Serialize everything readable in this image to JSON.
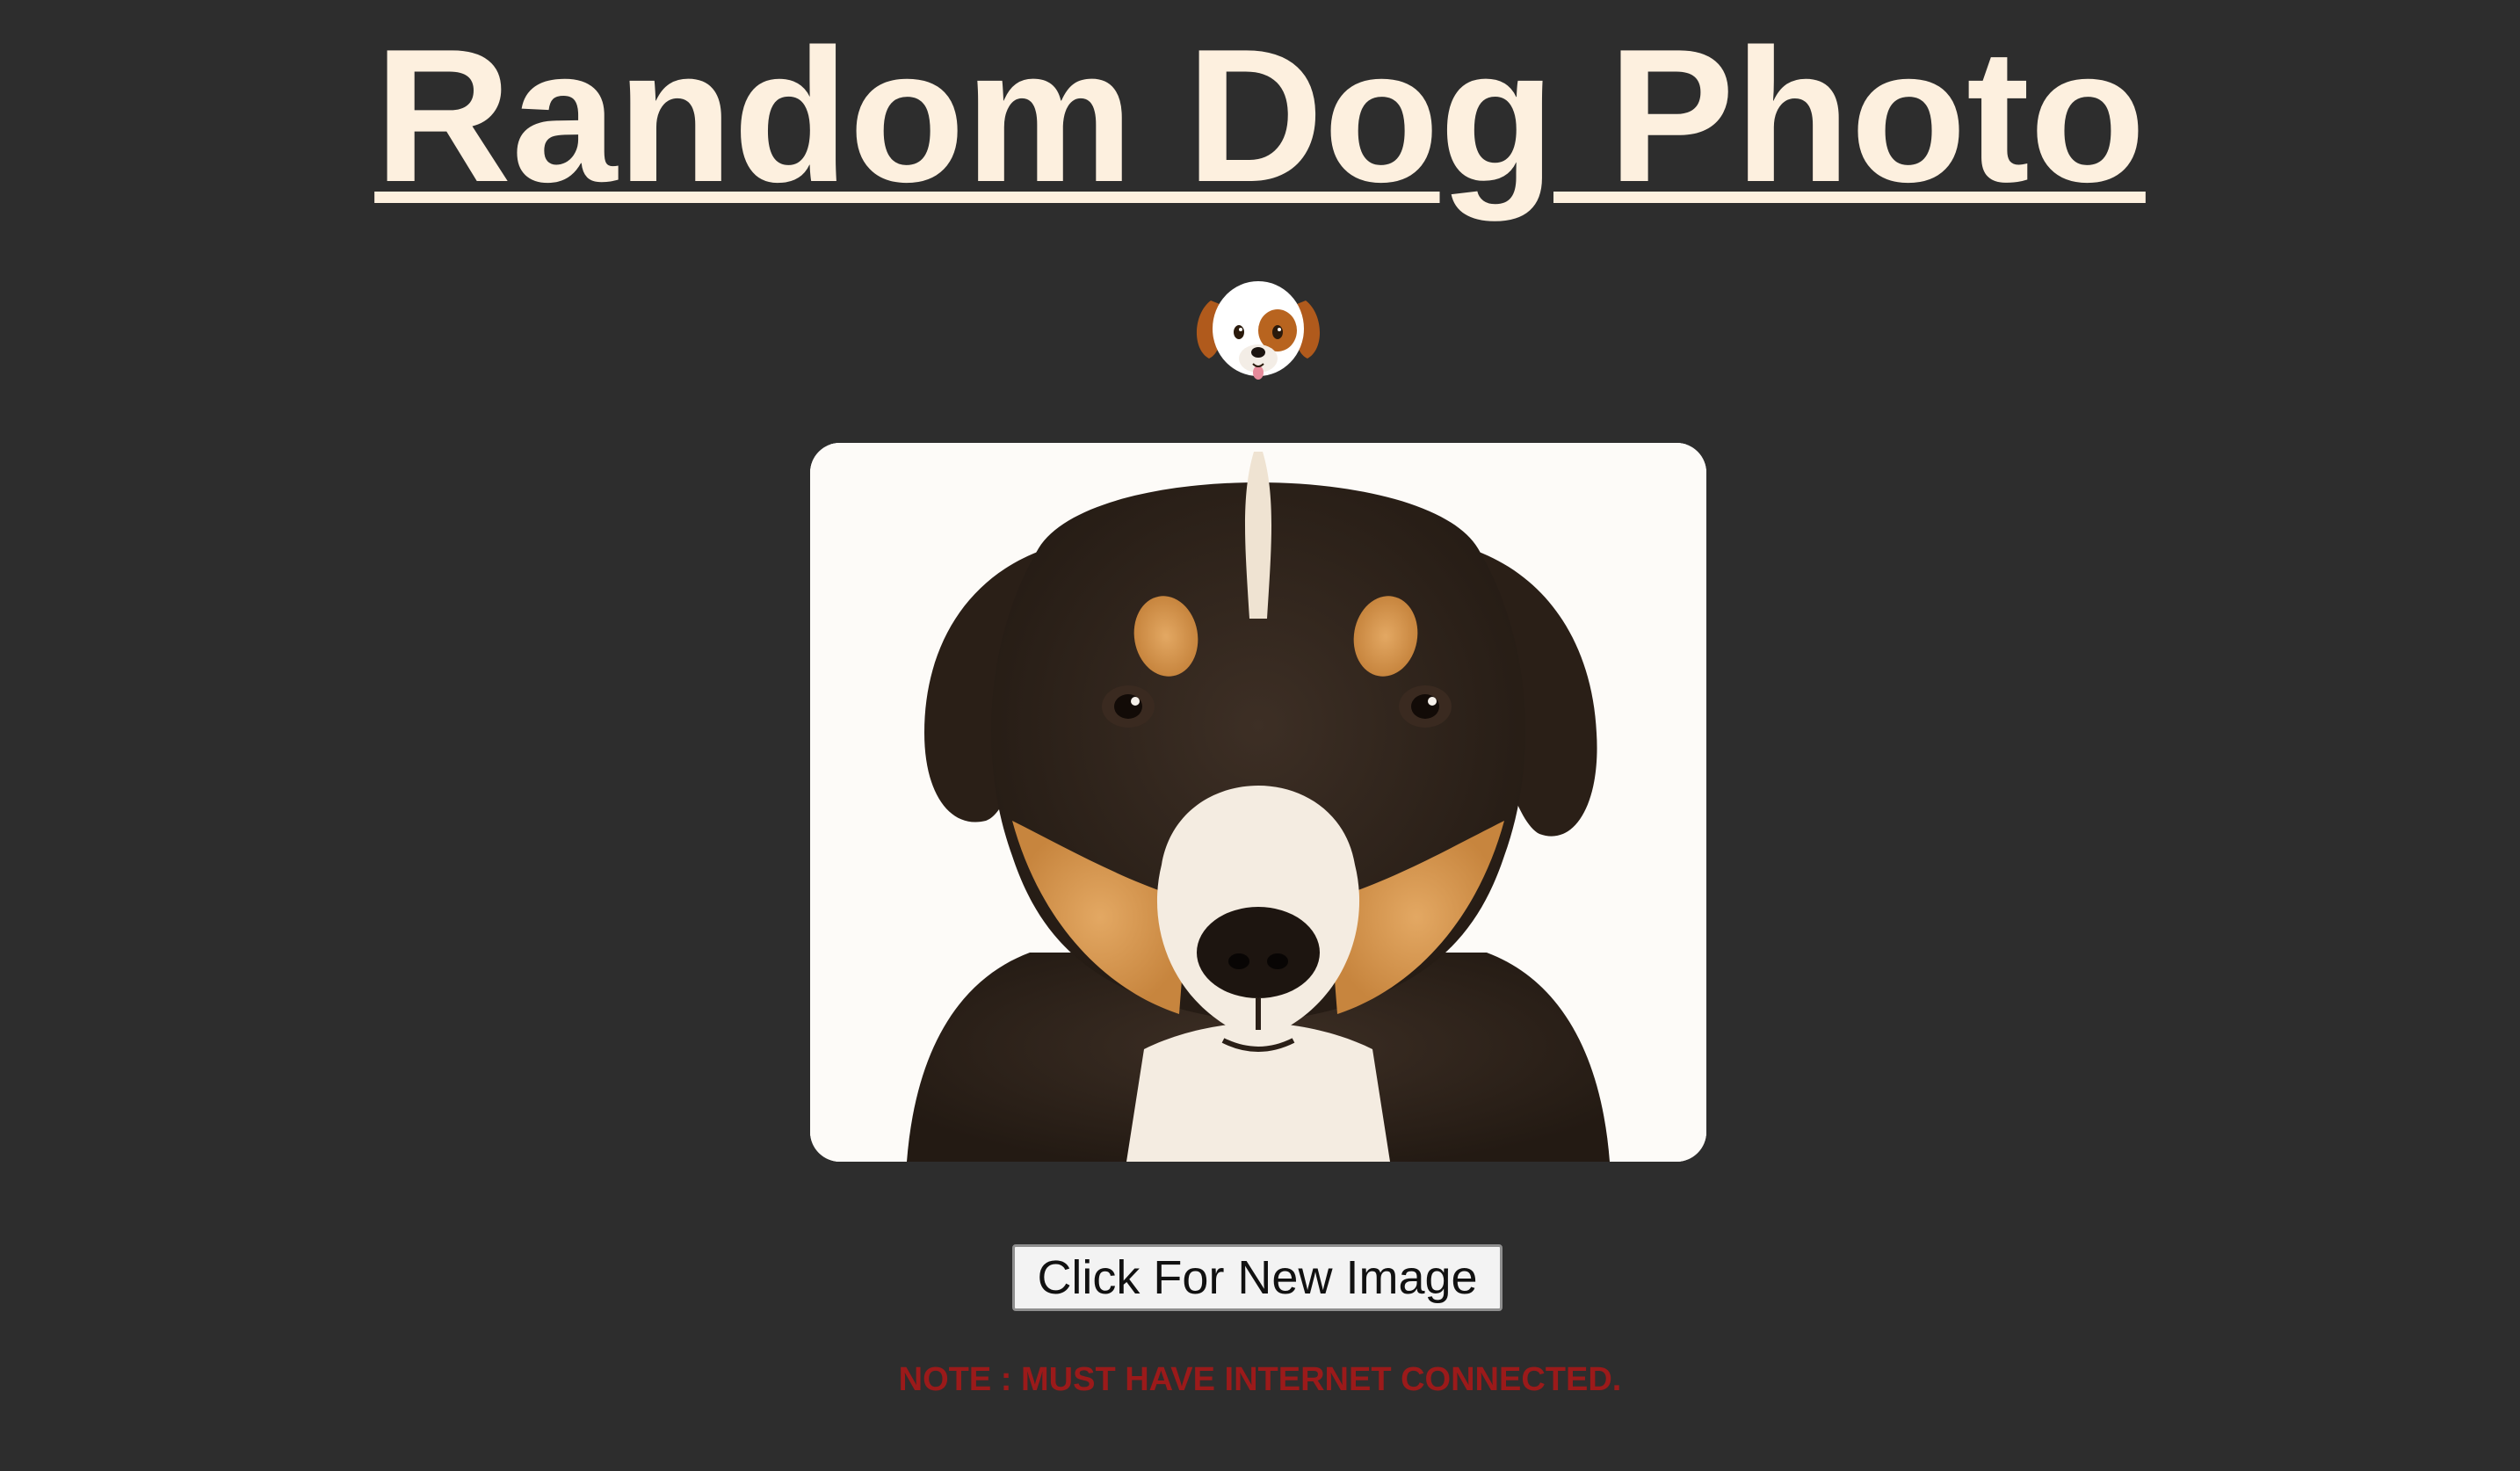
{
  "page": {
    "title": "Random Dog Photo",
    "emoji_icon": "dog-face-icon",
    "photo_alt": "puppy-photo",
    "button_label": "Click For New Image",
    "note": "NOTE : MUST HAVE INTERNET CONNECTED."
  },
  "colors": {
    "background": "#2d2d2d",
    "title": "#fdf0df",
    "note": "#9b1a1a",
    "button_bg": "#f3f3f3"
  }
}
